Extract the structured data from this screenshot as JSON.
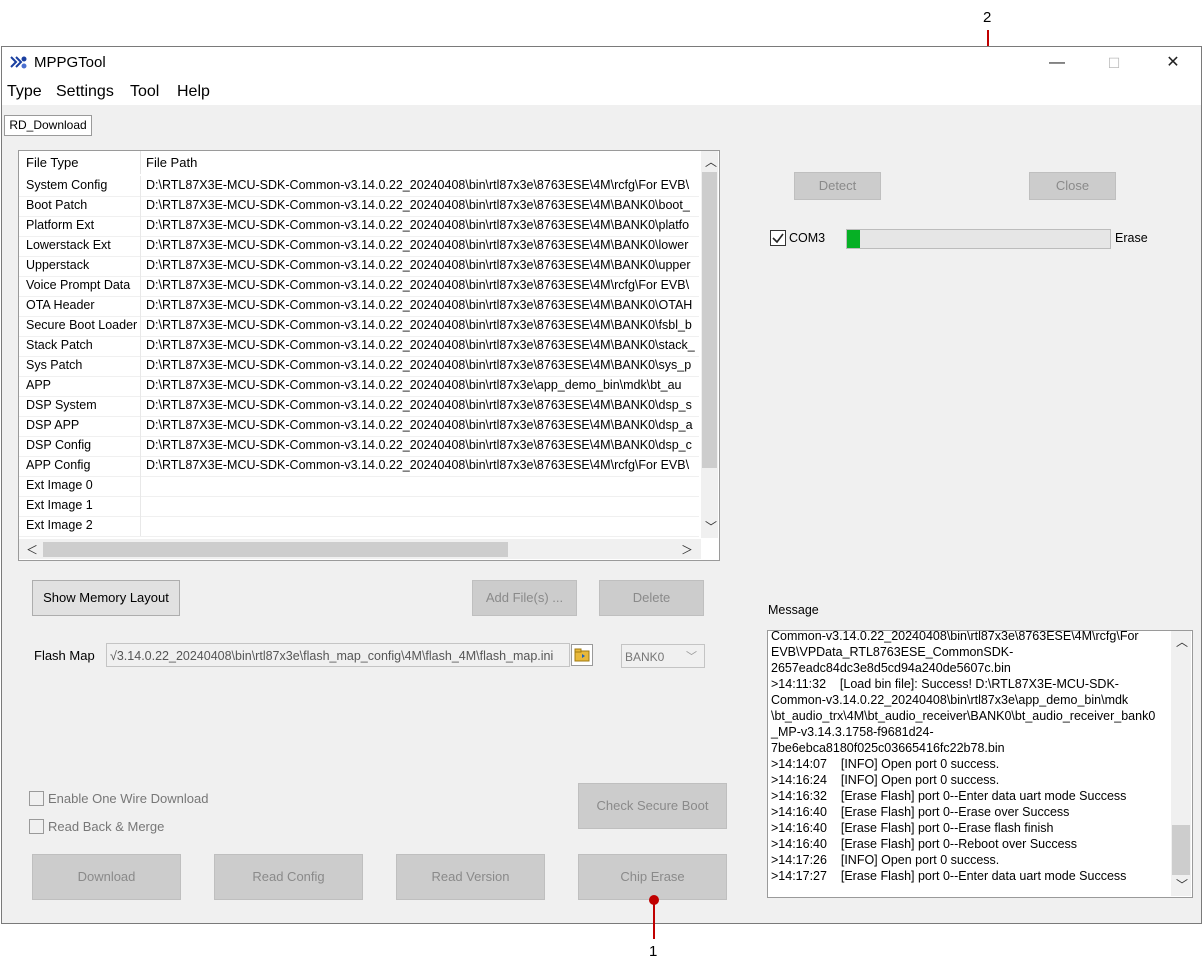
{
  "window": {
    "title": "MPPGTool",
    "minimize_glyph": "—",
    "maximize_glyph": "☐",
    "close_glyph": "✕"
  },
  "menu": [
    "Type",
    "Settings",
    "Tool",
    "Help"
  ],
  "tab_label": "RD_Download",
  "file_table": {
    "headers": {
      "type": "File Type",
      "path": "File Path"
    },
    "rows": [
      {
        "type": "System Config",
        "path": "D:\\RTL87X3E-MCU-SDK-Common-v3.14.0.22_20240408\\bin\\rtl87x3e\\8763ESE\\4M\\rcfg\\For EVB\\"
      },
      {
        "type": "Boot Patch",
        "path": "D:\\RTL87X3E-MCU-SDK-Common-v3.14.0.22_20240408\\bin\\rtl87x3e\\8763ESE\\4M\\BANK0\\boot_"
      },
      {
        "type": "Platform Ext",
        "path": "D:\\RTL87X3E-MCU-SDK-Common-v3.14.0.22_20240408\\bin\\rtl87x3e\\8763ESE\\4M\\BANK0\\platfo"
      },
      {
        "type": "Lowerstack Ext",
        "path": "D:\\RTL87X3E-MCU-SDK-Common-v3.14.0.22_20240408\\bin\\rtl87x3e\\8763ESE\\4M\\BANK0\\lower"
      },
      {
        "type": "Upperstack",
        "path": "D:\\RTL87X3E-MCU-SDK-Common-v3.14.0.22_20240408\\bin\\rtl87x3e\\8763ESE\\4M\\BANK0\\upper"
      },
      {
        "type": "Voice Prompt Data",
        "path": "D:\\RTL87X3E-MCU-SDK-Common-v3.14.0.22_20240408\\bin\\rtl87x3e\\8763ESE\\4M\\rcfg\\For EVB\\"
      },
      {
        "type": "OTA Header",
        "path": "D:\\RTL87X3E-MCU-SDK-Common-v3.14.0.22_20240408\\bin\\rtl87x3e\\8763ESE\\4M\\BANK0\\OTAH"
      },
      {
        "type": "Secure Boot Loader",
        "path": "D:\\RTL87X3E-MCU-SDK-Common-v3.14.0.22_20240408\\bin\\rtl87x3e\\8763ESE\\4M\\BANK0\\fsbl_b"
      },
      {
        "type": "Stack Patch",
        "path": "D:\\RTL87X3E-MCU-SDK-Common-v3.14.0.22_20240408\\bin\\rtl87x3e\\8763ESE\\4M\\BANK0\\stack_"
      },
      {
        "type": "Sys Patch",
        "path": "D:\\RTL87X3E-MCU-SDK-Common-v3.14.0.22_20240408\\bin\\rtl87x3e\\8763ESE\\4M\\BANK0\\sys_p"
      },
      {
        "type": "APP",
        "path": "D:\\RTL87X3E-MCU-SDK-Common-v3.14.0.22_20240408\\bin\\rtl87x3e\\app_demo_bin\\mdk\\bt_au"
      },
      {
        "type": "DSP System",
        "path": "D:\\RTL87X3E-MCU-SDK-Common-v3.14.0.22_20240408\\bin\\rtl87x3e\\8763ESE\\4M\\BANK0\\dsp_s"
      },
      {
        "type": "DSP APP",
        "path": "D:\\RTL87X3E-MCU-SDK-Common-v3.14.0.22_20240408\\bin\\rtl87x3e\\8763ESE\\4M\\BANK0\\dsp_a"
      },
      {
        "type": "DSP Config",
        "path": "D:\\RTL87X3E-MCU-SDK-Common-v3.14.0.22_20240408\\bin\\rtl87x3e\\8763ESE\\4M\\BANK0\\dsp_c"
      },
      {
        "type": "APP Config",
        "path": "D:\\RTL87X3E-MCU-SDK-Common-v3.14.0.22_20240408\\bin\\rtl87x3e\\8763ESE\\4M\\rcfg\\For EVB\\"
      },
      {
        "type": "Ext Image 0",
        "path": ""
      },
      {
        "type": "Ext Image 1",
        "path": ""
      },
      {
        "type": "Ext Image 2",
        "path": ""
      }
    ]
  },
  "buttons": {
    "show_memory_layout": "Show Memory Layout",
    "add_files": "Add File(s) ...",
    "delete": "Delete",
    "detect": "Detect",
    "close": "Close",
    "check_secure_boot": "Check Secure Boot",
    "download": "Download",
    "read_config": "Read Config",
    "read_version": "Read Version",
    "chip_erase": "Chip Erase"
  },
  "flash_map": {
    "label": "Flash Map",
    "value": "√3.14.0.22_20240408\\bin\\rtl87x3e\\flash_map_config\\4M\\flash_4M\\flash_map.ini",
    "bank": "BANK0"
  },
  "options": {
    "one_wire": {
      "label": "Enable One Wire Download",
      "checked": false
    },
    "read_back": {
      "label": "Read Back & Merge",
      "checked": false
    }
  },
  "port": {
    "name": "COM3",
    "checked": true,
    "status": "Erase",
    "progress": 0.05,
    "progress_color": "#06b025"
  },
  "message": {
    "label": "Message",
    "lines": [
      "Common-v3.14.0.22_20240408\\bin\\rtl87x3e\\8763ESE\\4M\\rcfg\\For",
      "EVB\\VPData_RTL8763ESE_CommonSDK-",
      "2657eadc84dc3e8d5cd94a240de5607c.bin",
      ">14:11:32    [Load bin file]: Success! D:\\RTL87X3E-MCU-SDK-",
      "Common-v3.14.0.22_20240408\\bin\\rtl87x3e\\app_demo_bin\\mdk",
      "\\bt_audio_trx\\4M\\bt_audio_receiver\\BANK0\\bt_audio_receiver_bank0",
      "_MP-v3.14.3.1758-f9681d24-",
      "7be6ebca8180f025c03665416fc22b78.bin",
      ">14:14:07    [INFO] Open port 0 success.",
      ">14:16:24    [INFO] Open port 0 success.",
      ">14:16:32    [Erase Flash] port 0--Enter data uart mode Success",
      ">14:16:40    [Erase Flash] port 0--Erase over Success",
      ">14:16:40    [Erase Flash] port 0--Erase flash finish",
      ">14:16:40    [Erase Flash] port 0--Reboot over Success",
      ">14:17:26    [INFO] Open port 0 success.",
      ">14:17:27    [Erase Flash] port 0--Enter data uart mode Success"
    ]
  },
  "callouts": {
    "one": "1",
    "two": "2"
  },
  "colors": {
    "callout": "#c00000",
    "accent_progress": "#06b025"
  }
}
